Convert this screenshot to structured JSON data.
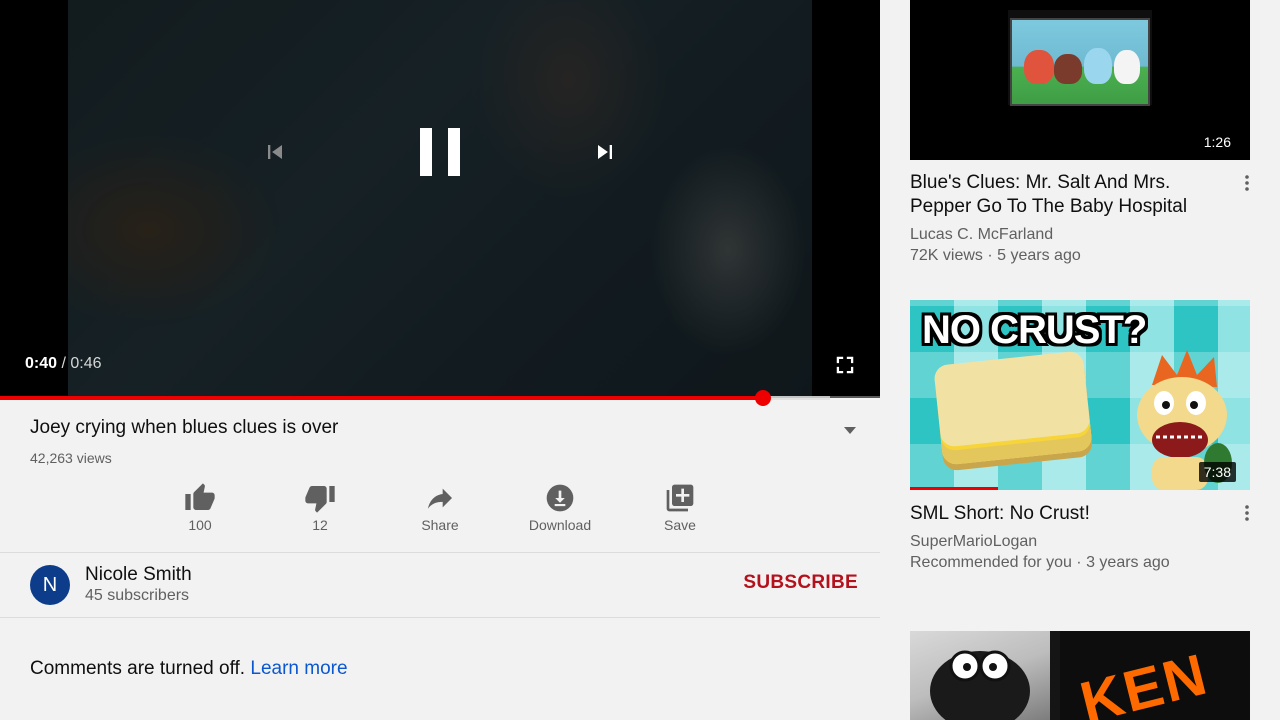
{
  "player": {
    "time_current": "0:40",
    "time_separator": " / ",
    "time_total": "0:46",
    "progress_fraction": 0.867,
    "buffered_fraction": 0.943
  },
  "video": {
    "title": "Joey crying when blues clues is over",
    "views": "42,263 views"
  },
  "actions": {
    "like_count": "100",
    "dislike_count": "12",
    "share_label": "Share",
    "download_label": "Download",
    "save_label": "Save"
  },
  "channel": {
    "avatar_letter": "N",
    "avatar_color": "#0d3d8a",
    "name": "Nicole Smith",
    "subscribers": "45 subscribers",
    "subscribe_label": "SUBSCRIBE",
    "subscribe_color": "#b3121d"
  },
  "comments": {
    "text": "Comments are turned off.",
    "link": "Learn more"
  },
  "related": [
    {
      "duration": "1:26",
      "title": "Blue's Clues: Mr. Salt And Mrs. Pepper Go To The Baby Hospital",
      "channel": "Lucas C. McFarland",
      "meta": "72K views · 5 years ago"
    },
    {
      "duration": "7:38",
      "thumb_text": "NO CRUST?",
      "title": "SML Short: No Crust!",
      "channel": "SuperMarioLogan",
      "meta": "Recommended for you · 3 years ago",
      "watched_fraction": 0.26
    },
    {
      "thumb_text": "KEN"
    }
  ]
}
